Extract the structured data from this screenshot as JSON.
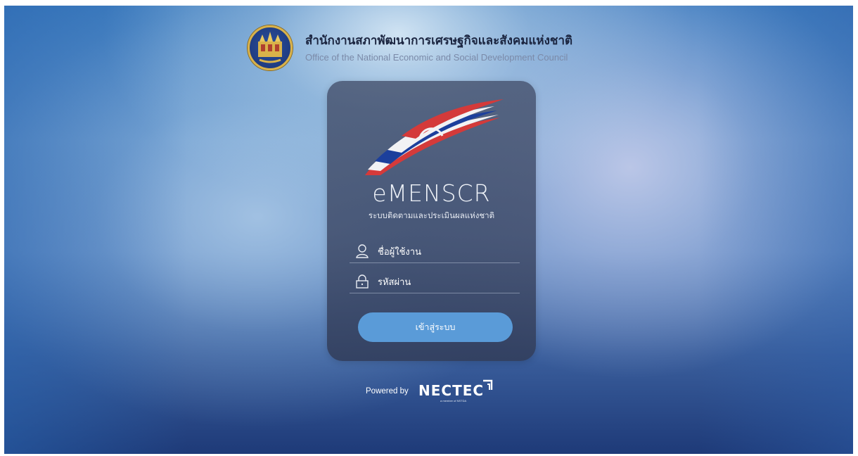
{
  "header": {
    "org_name_th": "สำนักงานสภาพัฒนาการเศรษฐกิจและสังคมแห่งชาติ",
    "org_name_en": "Office of the National Economic and Social Development Council",
    "seal_icon": "nesdc-seal-icon"
  },
  "login": {
    "app_name": "eMENSCR",
    "app_subtitle": "ระบบติดตามและประเมินผลแห่งชาติ",
    "username": {
      "value": "",
      "placeholder": "ชื่อผู้ใช้งาน",
      "icon": "user-icon"
    },
    "password": {
      "value": "",
      "placeholder": "รหัสผ่าน",
      "icon": "lock-icon"
    },
    "submit_label": "เข้าสู่ระบบ"
  },
  "footer": {
    "powered_by": "Powered by",
    "brand": "NECTEC",
    "brand_tagline": "a member of NSTDA"
  },
  "colors": {
    "button": "#5a9bd8",
    "card": "#46526e",
    "flag_red": "#d43a3a",
    "flag_blue": "#1c3f9c"
  }
}
